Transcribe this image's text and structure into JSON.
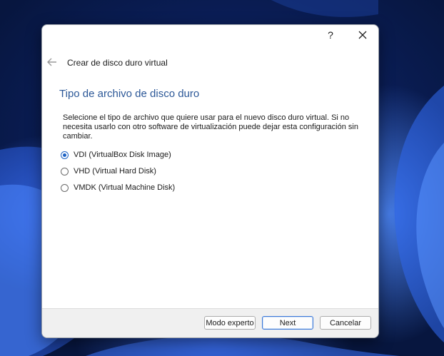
{
  "window": {
    "help_label": "?",
    "close_label": "✕"
  },
  "wizard": {
    "title": "Crear de disco duro virtual",
    "back_icon": "arrow-left-icon"
  },
  "page": {
    "heading": "Tipo de archivo de disco duro",
    "description": "Selecione el tipo de archivo que quiere usar para el nuevo disco duro virtual. Si no necesita usarlo con otro software de virtualización puede dejar esta configuración sin cambiar."
  },
  "options": [
    {
      "label": "VDI (VirtualBox Disk Image)",
      "checked": true
    },
    {
      "label": "VHD (Virtual Hard Disk)",
      "checked": false
    },
    {
      "label": "VMDK (Virtual Machine Disk)",
      "checked": false
    }
  ],
  "footer": {
    "expert_label": "Modo experto",
    "next_label": "Next",
    "cancel_label": "Cancelar"
  },
  "colors": {
    "heading": "#2b5797",
    "accent": "#1d62c4"
  }
}
